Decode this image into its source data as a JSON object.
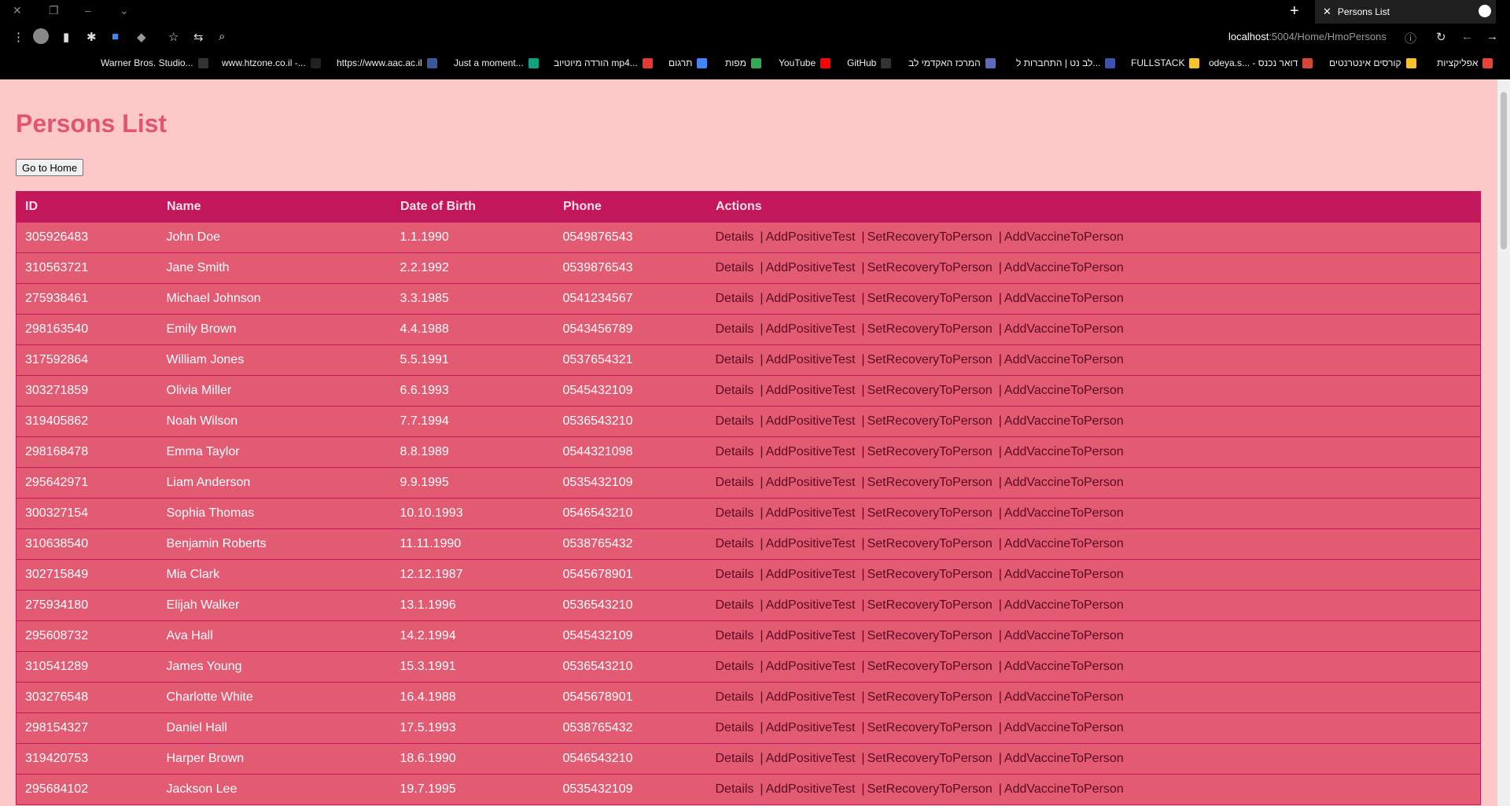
{
  "browser": {
    "tab_title": "Persons List",
    "url_host": "localhost",
    "url_rest": ":5004/Home/HmoPersons",
    "bookmarks": [
      {
        "label": "Warner Bros. Studio...",
        "color": "#333"
      },
      {
        "label": "www.htzone.co.il -...",
        "color": "#222"
      },
      {
        "label": "https://www.aac.ac.il",
        "color": "#3b5998"
      },
      {
        "label": "Just a moment...",
        "color": "#10a37f"
      },
      {
        "label": "הורדה מיוטיוב mp4...",
        "color": "#e53935"
      },
      {
        "label": "תרגום",
        "color": "#4285f4"
      },
      {
        "label": "מפות",
        "color": "#34a853"
      },
      {
        "label": "YouTube",
        "color": "#ff0000"
      },
      {
        "label": "GitHub",
        "color": "#333"
      },
      {
        "label": "המרכז האקדמי לב",
        "color": "#5c6bc0"
      },
      {
        "label": "לב נט | התחברות ל...",
        "color": "#3f51b5"
      },
      {
        "label": "FULLSTACK",
        "color": "#f4c430"
      },
      {
        "label": "odeya.s... - דואר נכנס",
        "color": "#d44638"
      },
      {
        "label": "קורסים אינטרנטים",
        "color": "#f4c430"
      },
      {
        "label": "אפליקציות",
        "color": "#ea4335"
      }
    ]
  },
  "page": {
    "title": "Persons List",
    "home_button": "Go to Home"
  },
  "table": {
    "headers": [
      "ID",
      "Name",
      "Date of Birth",
      "Phone",
      "Actions"
    ],
    "actions": [
      "Details",
      "AddPositiveTest",
      "SetRecoveryToPerson",
      "AddVaccineToPerson"
    ],
    "rows": [
      [
        "305926483",
        "John Doe",
        "1.1.1990",
        "0549876543"
      ],
      [
        "310563721",
        "Jane Smith",
        "2.2.1992",
        "0539876543"
      ],
      [
        "275938461",
        "Michael Johnson",
        "3.3.1985",
        "0541234567"
      ],
      [
        "298163540",
        "Emily Brown",
        "4.4.1988",
        "0543456789"
      ],
      [
        "317592864",
        "William Jones",
        "5.5.1991",
        "0537654321"
      ],
      [
        "303271859",
        "Olivia Miller",
        "6.6.1993",
        "0545432109"
      ],
      [
        "319405862",
        "Noah Wilson",
        "7.7.1994",
        "0536543210"
      ],
      [
        "298168478",
        "Emma Taylor",
        "8.8.1989",
        "0544321098"
      ],
      [
        "295642971",
        "Liam Anderson",
        "9.9.1995",
        "0535432109"
      ],
      [
        "300327154",
        "Sophia Thomas",
        "10.10.1993",
        "0546543210"
      ],
      [
        "310638540",
        "Benjamin Roberts",
        "11.11.1990",
        "0538765432"
      ],
      [
        "302715849",
        "Mia Clark",
        "12.12.1987",
        "0545678901"
      ],
      [
        "275934180",
        "Elijah Walker",
        "13.1.1996",
        "0536543210"
      ],
      [
        "295608732",
        "Ava Hall",
        "14.2.1994",
        "0545432109"
      ],
      [
        "310541289",
        "James Young",
        "15.3.1991",
        "0536543210"
      ],
      [
        "303276548",
        "Charlotte White",
        "16.4.1988",
        "0545678901"
      ],
      [
        "298154327",
        "Daniel Hall",
        "17.5.1993",
        "0538765432"
      ],
      [
        "319420753",
        "Harper Brown",
        "18.6.1990",
        "0546543210"
      ],
      [
        "295684102",
        "Jackson Lee",
        "19.7.1995",
        "0535432109"
      ]
    ]
  }
}
